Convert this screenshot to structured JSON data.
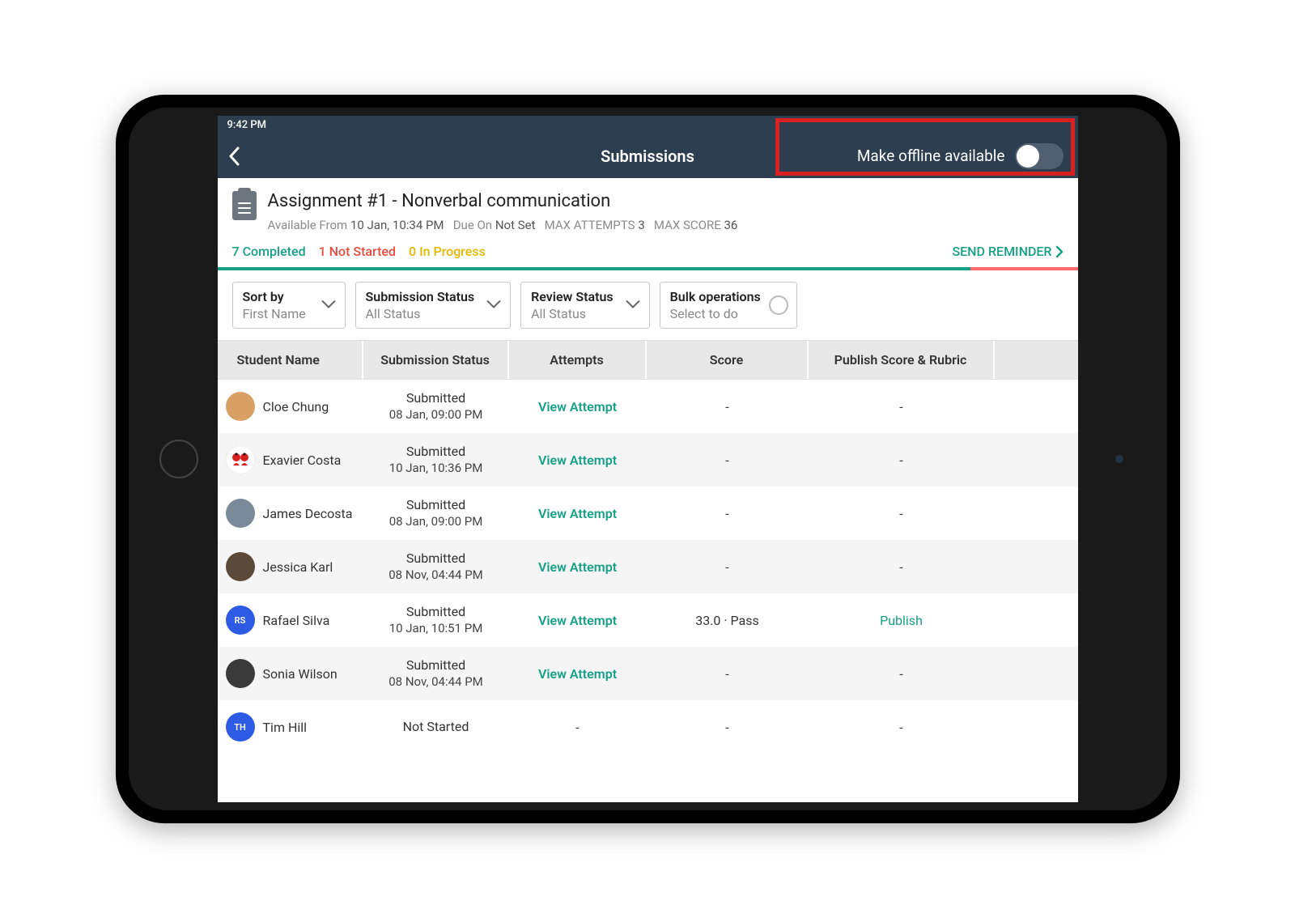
{
  "status_bar": {
    "time": "9:42 PM"
  },
  "title_bar": {
    "title": "Submissions",
    "offline_label": "Make offline available"
  },
  "assignment": {
    "title": "Assignment #1 - Nonverbal communication",
    "available_from_label": "Available From",
    "available_from_value": "10 Jan, 10:34 PM",
    "due_on_label": "Due On",
    "due_on_value": "Not Set",
    "max_attempts_label": "MAX ATTEMPTS",
    "max_attempts_value": "3",
    "max_score_label": "MAX SCORE",
    "max_score_value": "36"
  },
  "progress": {
    "completed": "7 Completed",
    "not_started": "1 Not Started",
    "in_progress": "0 In Progress",
    "reminder": "SEND REMINDER",
    "completed_pct": 87.5,
    "not_started_pct": 12.5
  },
  "filters": {
    "sort_label": "Sort by",
    "sort_value": "First Name",
    "sub_status_label": "Submission Status",
    "sub_status_value": "All Status",
    "review_status_label": "Review Status",
    "review_status_value": "All Status",
    "bulk_label": "Bulk operations",
    "bulk_value": "Select to do"
  },
  "columns": {
    "c1": "Student Name",
    "c2": "Submission Status",
    "c3": "Attempts",
    "c4": "Score",
    "c5": "Publish Score & Rubric"
  },
  "labels": {
    "view_attempt": "View Attempt",
    "publish": "Publish"
  },
  "students": [
    {
      "name": "Cloe Chung",
      "status": "Submitted",
      "time": "08 Jan, 09:00 PM",
      "attempt": true,
      "score": "-",
      "publish": "-",
      "avatar_bg": "#d9a066",
      "avatar_initials": ""
    },
    {
      "name": "Exavier Costa",
      "status": "Submitted",
      "time": "10 Jan, 10:36 PM",
      "attempt": true,
      "score": "-",
      "publish": "-",
      "avatar_bg": "#ffffff",
      "avatar_initials": "",
      "avatar_variant": "twins"
    },
    {
      "name": "James Decosta",
      "status": "Submitted",
      "time": "08 Jan, 09:00 PM",
      "attempt": true,
      "score": "-",
      "publish": "-",
      "avatar_bg": "#7a8a99",
      "avatar_initials": ""
    },
    {
      "name": "Jessica Karl",
      "status": "Submitted",
      "time": "08 Nov, 04:44 PM",
      "attempt": true,
      "score": "-",
      "publish": "-",
      "avatar_bg": "#5a4a3a",
      "avatar_initials": ""
    },
    {
      "name": "Rafael Silva",
      "status": "Submitted",
      "time": "10 Jan, 10:51 PM",
      "attempt": true,
      "score": "33.0 · Pass",
      "publish": "link",
      "avatar_bg": "#2d5be3",
      "avatar_initials": "RS"
    },
    {
      "name": "Sonia Wilson",
      "status": "Submitted",
      "time": "08 Nov, 04:44 PM",
      "attempt": true,
      "score": "-",
      "publish": "-",
      "avatar_bg": "#3a3a3a",
      "avatar_initials": ""
    },
    {
      "name": "Tim Hill",
      "status": "Not Started",
      "time": "",
      "attempt": false,
      "score": "-",
      "publish": "-",
      "avatar_bg": "#2d5be3",
      "avatar_initials": "TH"
    }
  ]
}
